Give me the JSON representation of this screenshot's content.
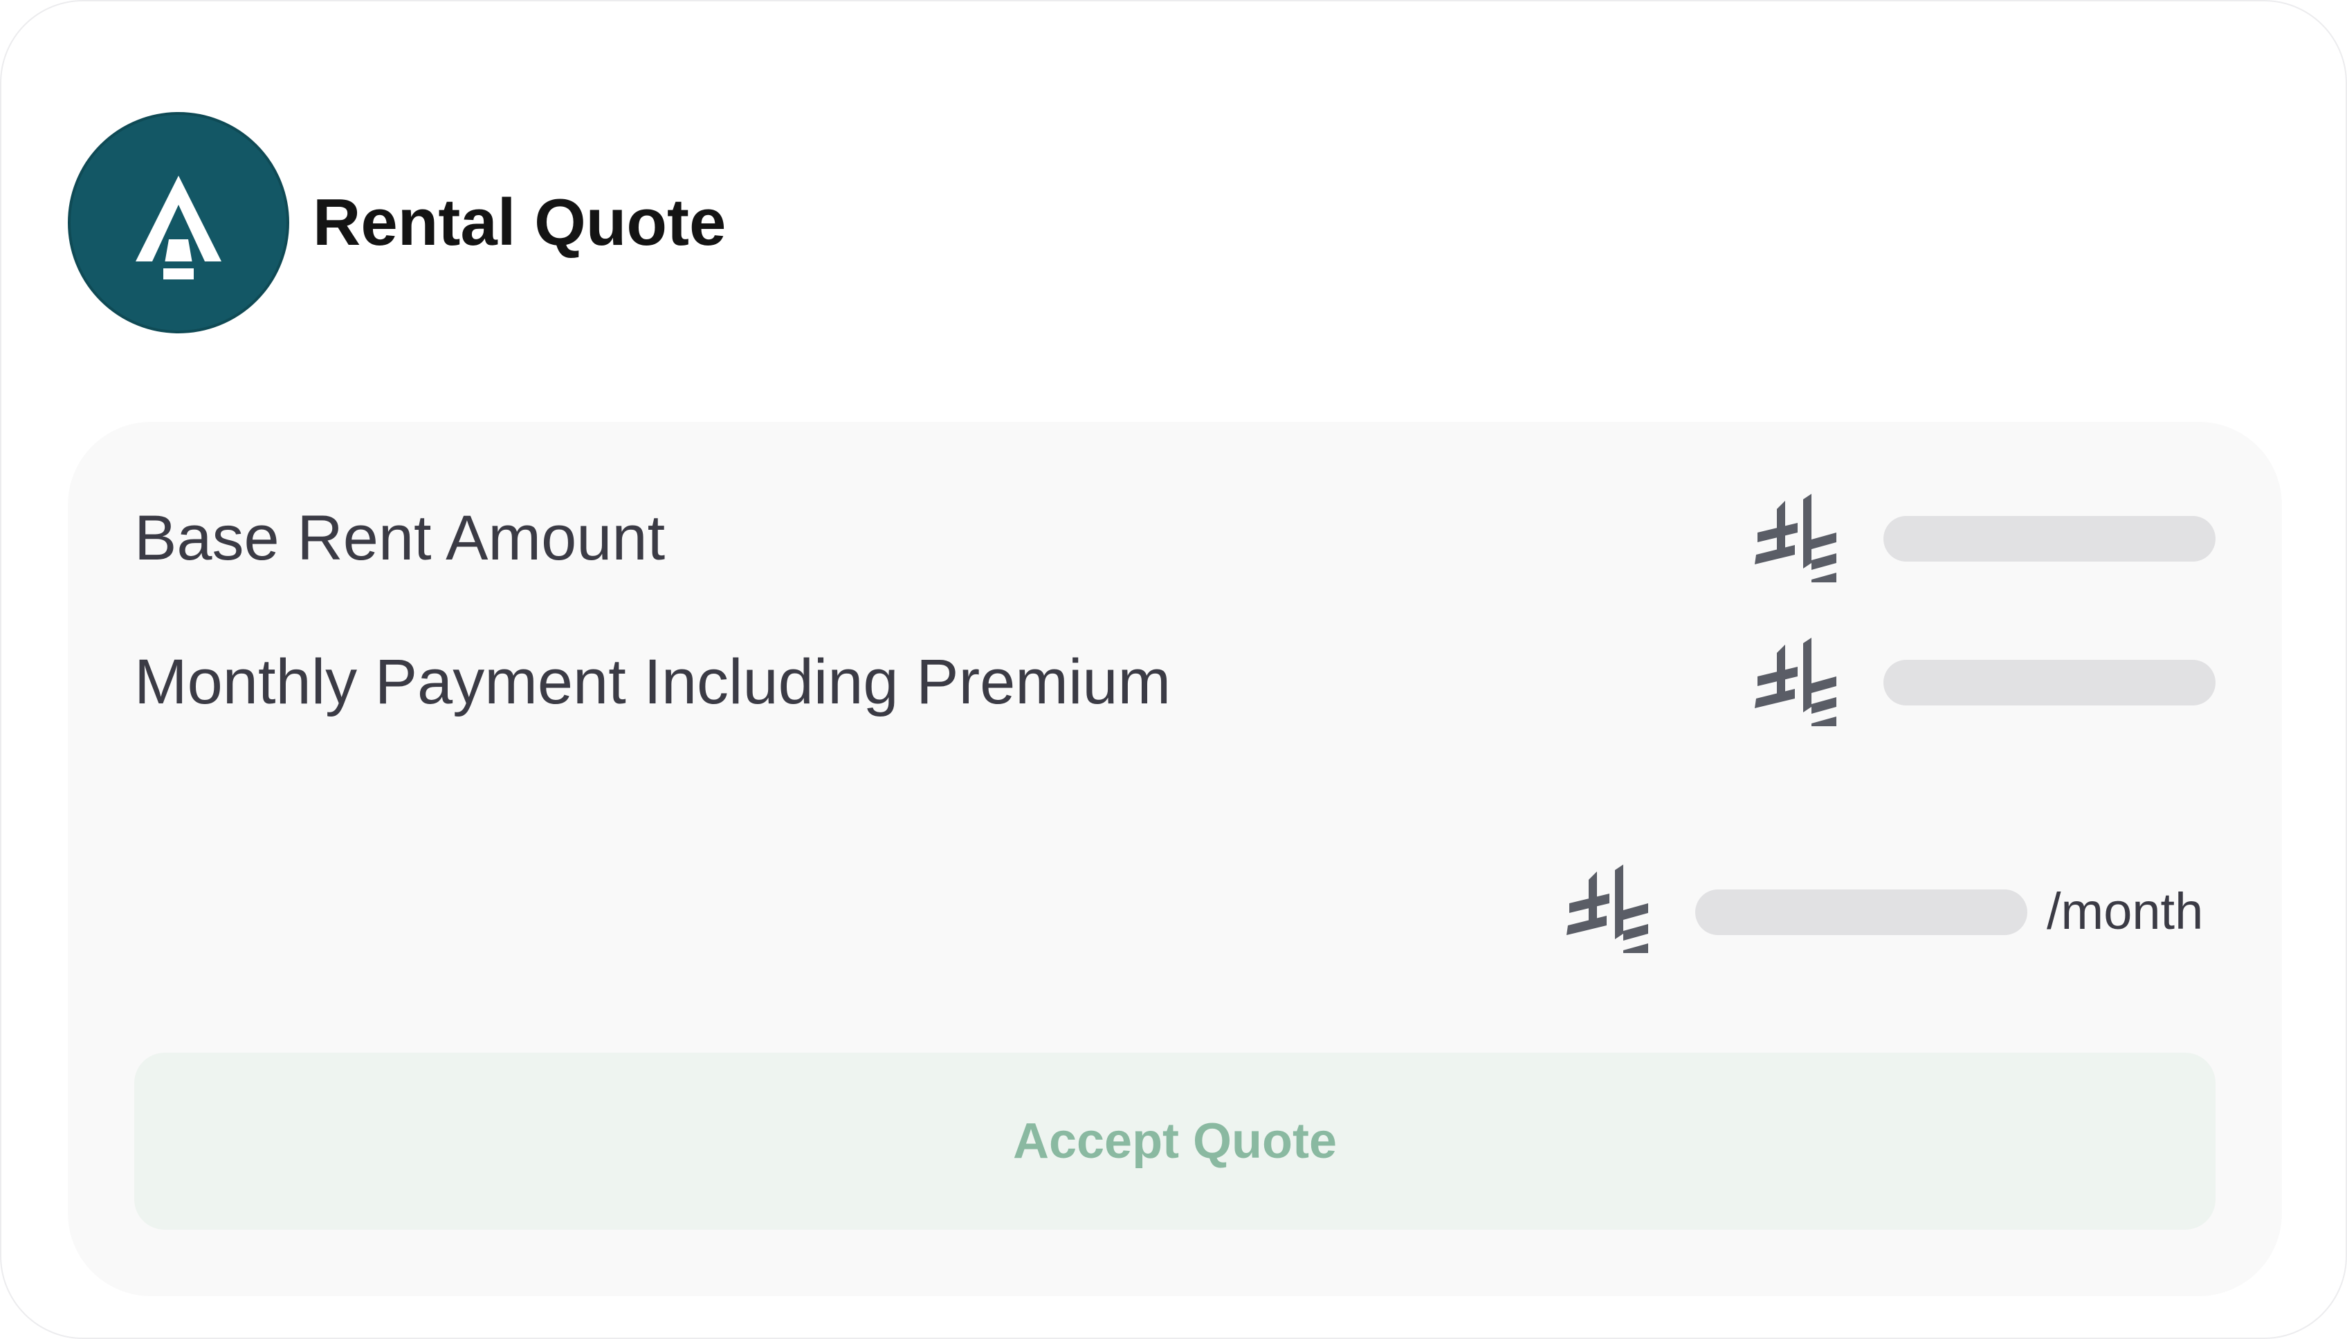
{
  "header": {
    "title": "Rental Quote",
    "logo_icon": "brand-a-logo-icon",
    "logo_color": "#135765"
  },
  "quote": {
    "rows": [
      {
        "label": "Base Rent Amount",
        "currency_icon": "saudi-riyal-icon",
        "value_state": "loading"
      },
      {
        "label": "Monthly Payment Including Premium",
        "currency_icon": "saudi-riyal-icon",
        "value_state": "loading"
      }
    ],
    "total": {
      "currency_icon": "saudi-riyal-icon",
      "value_state": "loading",
      "period_suffix": "/month"
    },
    "accept_button_label": "Accept Quote"
  },
  "colors": {
    "panel_background": "#f9f9f9",
    "button_background": "#eef4f0",
    "button_text": "#8ab9a1",
    "placeholder": "#e1e1e3",
    "icon": "#5a5d66"
  }
}
